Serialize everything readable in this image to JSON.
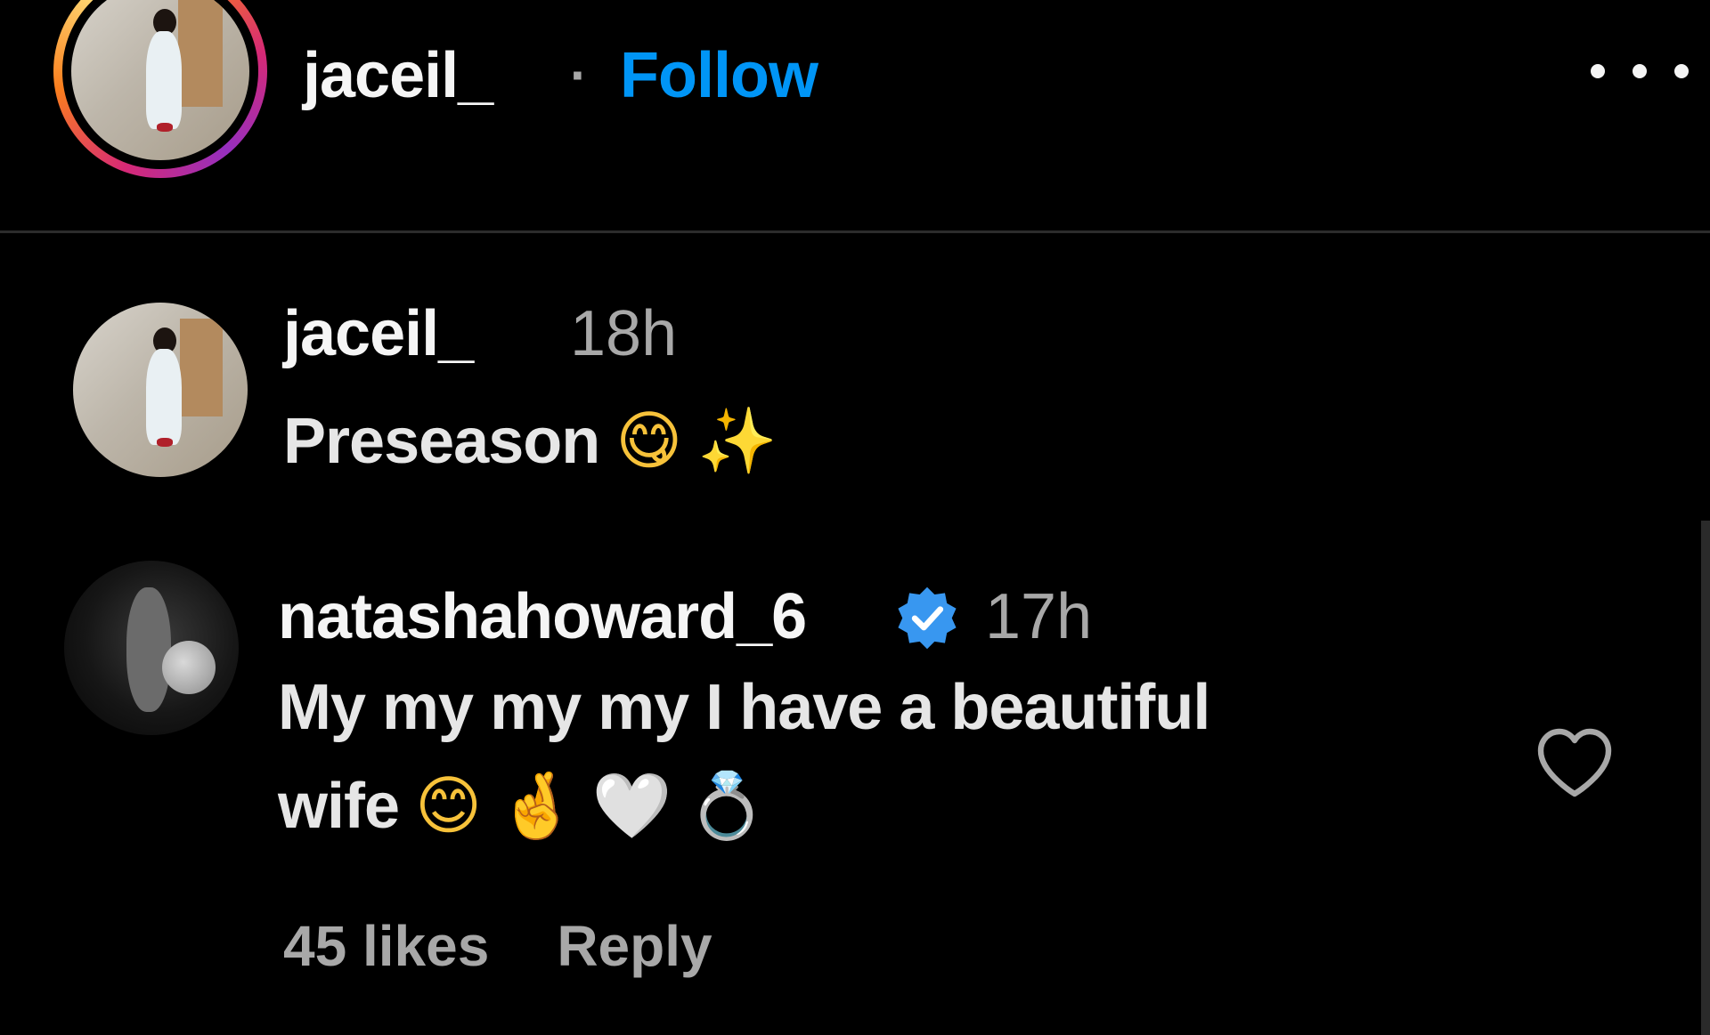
{
  "post_header": {
    "username": "jaceil_",
    "separator": "·",
    "follow_label": "Follow",
    "more_icon": "more-horizontal-icon"
  },
  "comments": [
    {
      "username": "jaceil_",
      "time": "18h",
      "text": "Preseason",
      "emojis": [
        "😋",
        "✨"
      ]
    },
    {
      "username": "natashahoward_6",
      "verified": true,
      "time": "17h",
      "text_line1": "My my my my I have a beautiful",
      "text_line2": "wife",
      "emojis": [
        "😊",
        "🤞",
        "🤍",
        "💍"
      ],
      "likes": "45 likes",
      "reply_label": "Reply",
      "like_icon": "heart-outline-icon"
    }
  ],
  "colors": {
    "background": "#000000",
    "follow_blue": "#0095f6",
    "verified_blue": "#3897f0",
    "muted_text": "#a8a8a8"
  }
}
